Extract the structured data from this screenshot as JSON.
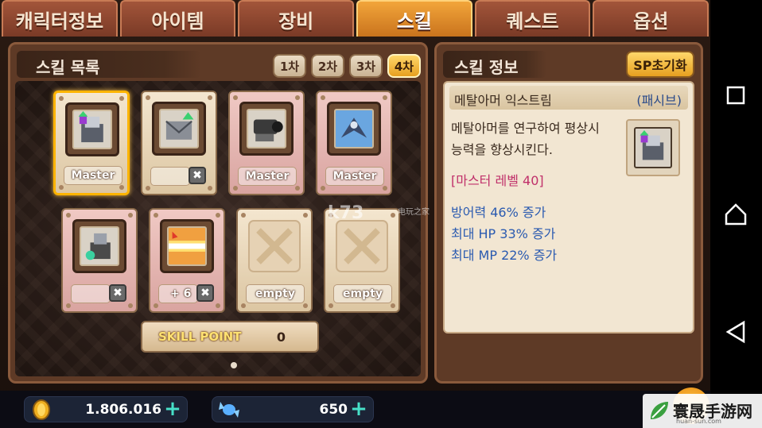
{
  "tabs": [
    "캐릭터정보",
    "아이템",
    "장비",
    "스킬",
    "퀘스트",
    "옵션"
  ],
  "active_tab": "스킬",
  "skill_list": {
    "title": "스킬 목록",
    "grades": [
      "1차",
      "2차",
      "3차",
      "4차"
    ],
    "active_grade": "4차",
    "skills": [
      {
        "label": "Master",
        "style": "beige",
        "selected": true,
        "icon": "metal-armor-extreme-icon"
      },
      {
        "label": "",
        "style": "beige",
        "removable": true,
        "icon": "envelope-upgrade-icon"
      },
      {
        "label": "Master",
        "style": "pink",
        "icon": "cannon-icon"
      },
      {
        "label": "Master",
        "style": "pink",
        "icon": "mech-jet-icon"
      },
      {
        "label": "",
        "style": "pink",
        "removable": true,
        "icon": "robot-factory-icon"
      },
      {
        "label": "+ 6",
        "style": "pink",
        "removable": true,
        "icon": "laser-blast-icon"
      },
      {
        "label": "empty",
        "style": "beige",
        "empty": true
      },
      {
        "label": "empty",
        "style": "beige",
        "empty": true
      }
    ],
    "skill_point_label": "SKILL POINT",
    "skill_point_value": "0"
  },
  "skill_info": {
    "title": "스킬 정보",
    "reset_button": "SP초기화",
    "skill_name": "메탈아머 익스트림",
    "skill_type": "(패시브)",
    "description_line1": "메탈아머를 연구하여 평상시",
    "description_line2": "능력을 향상시킨다.",
    "master_level": "[마스터 레벨 40]",
    "effects": [
      "방어력 46% 증가",
      "최대 HP 33% 증가",
      "최대 MP 22% 증가"
    ]
  },
  "currency": {
    "meso": "1.806.016",
    "gems": "650"
  },
  "watermark": {
    "site": "k73",
    "sub": "电玩之家"
  },
  "logo": {
    "text": "寰晟手游网",
    "sub": "huan-sun.com"
  },
  "colors": {
    "accent": "#f2a53a",
    "master_text": "#c0306a",
    "effect_text": "#2a5ab0"
  }
}
